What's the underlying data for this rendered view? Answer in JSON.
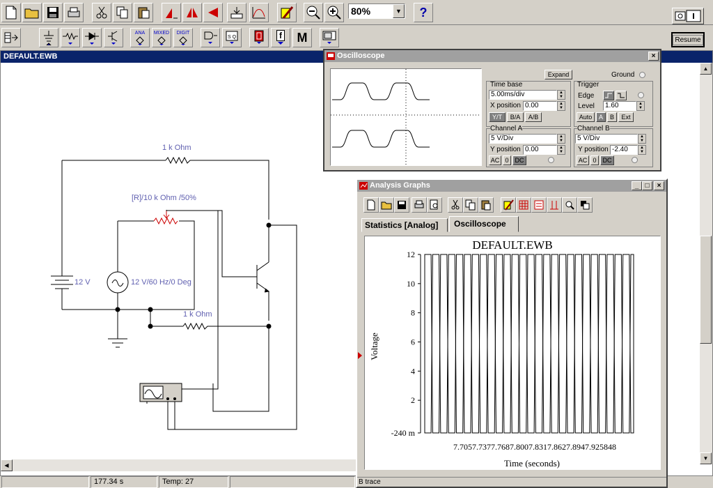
{
  "toolbar": {
    "zoom_value": "80%",
    "help_label": "?",
    "resume_label": "Resume"
  },
  "parts_bin": {
    "ana_label": "ANA",
    "mixed_label": "MIXED",
    "digit_label": "DIGIT",
    "m_label": "M",
    "f_label": "f"
  },
  "circuit": {
    "title": "DEFAULT.EWB",
    "r_top_label": "1 k Ohm",
    "pot_label": "[R]/10 k Ohm /50%",
    "battery_label": "12 V",
    "ac_source_label": "12 V/60 Hz/0 Deg",
    "r_bottom_label": "1 k Ohm"
  },
  "oscilloscope": {
    "title": "Oscilloscope",
    "expand_label": "Expand",
    "ground_label": "Ground",
    "timebase_label": "Time base",
    "timebase_value": "5.00ms/div",
    "xpos_label": "X position",
    "xpos_value": "0.00",
    "mode_yt": "Y/T",
    "mode_ba": "B/A",
    "mode_ab": "A/B",
    "trigger_label": "Trigger",
    "edge_label": "Edge",
    "level_label": "Level",
    "level_value": "1.60",
    "auto_label": "Auto",
    "a_label": "A",
    "b_label": "B",
    "ext_label": "Ext",
    "chA_label": "Channel A",
    "chA_vdiv": "5  V/Div",
    "chA_ypos_label": "Y position",
    "chA_ypos": "0.00",
    "chB_label": "Channel B",
    "chB_vdiv": "5  V/Div",
    "chB_ypos_label": "Y position",
    "chB_ypos": "-2.40",
    "ac_label": "AC",
    "zero_label": "0",
    "dc_label": "DC"
  },
  "analysis": {
    "title": "Analysis Graphs",
    "tab1": "Statistics [Analog]",
    "tab2": "Oscilloscope"
  },
  "chart_data": {
    "type": "line",
    "title": "DEFAULT.EWB",
    "xlabel": "Time (seconds)",
    "ylabel": "Voltage",
    "yticks": [
      "-240  m",
      "2",
      "4",
      "6",
      "8",
      "10",
      "12"
    ],
    "ytick_values": [
      -0.24,
      2,
      4,
      6,
      8,
      10,
      12
    ],
    "xticks": [
      "7.705",
      "7.737",
      "7.768",
      "7.800",
      "7.831",
      "7.862",
      "7.894",
      "7.925"
    ],
    "xtick_values": [
      7.705,
      7.737,
      7.768,
      7.8,
      7.831,
      7.862,
      7.894,
      7.925
    ],
    "xlim": [
      7.705,
      7.925
    ],
    "ylim": [
      -0.24,
      12
    ],
    "x_tick_text": "7.7057.7377.7687.8007.8317.8627.8947.925848",
    "period_s": 0.0167,
    "series": [
      {
        "name": "",
        "min": -0.24,
        "max": 12
      },
      {
        "name": "",
        "min": -0.24,
        "max": 12
      }
    ]
  },
  "status": {
    "time": "177.34 s",
    "temp": "Temp: 27",
    "trace": "B trace"
  }
}
